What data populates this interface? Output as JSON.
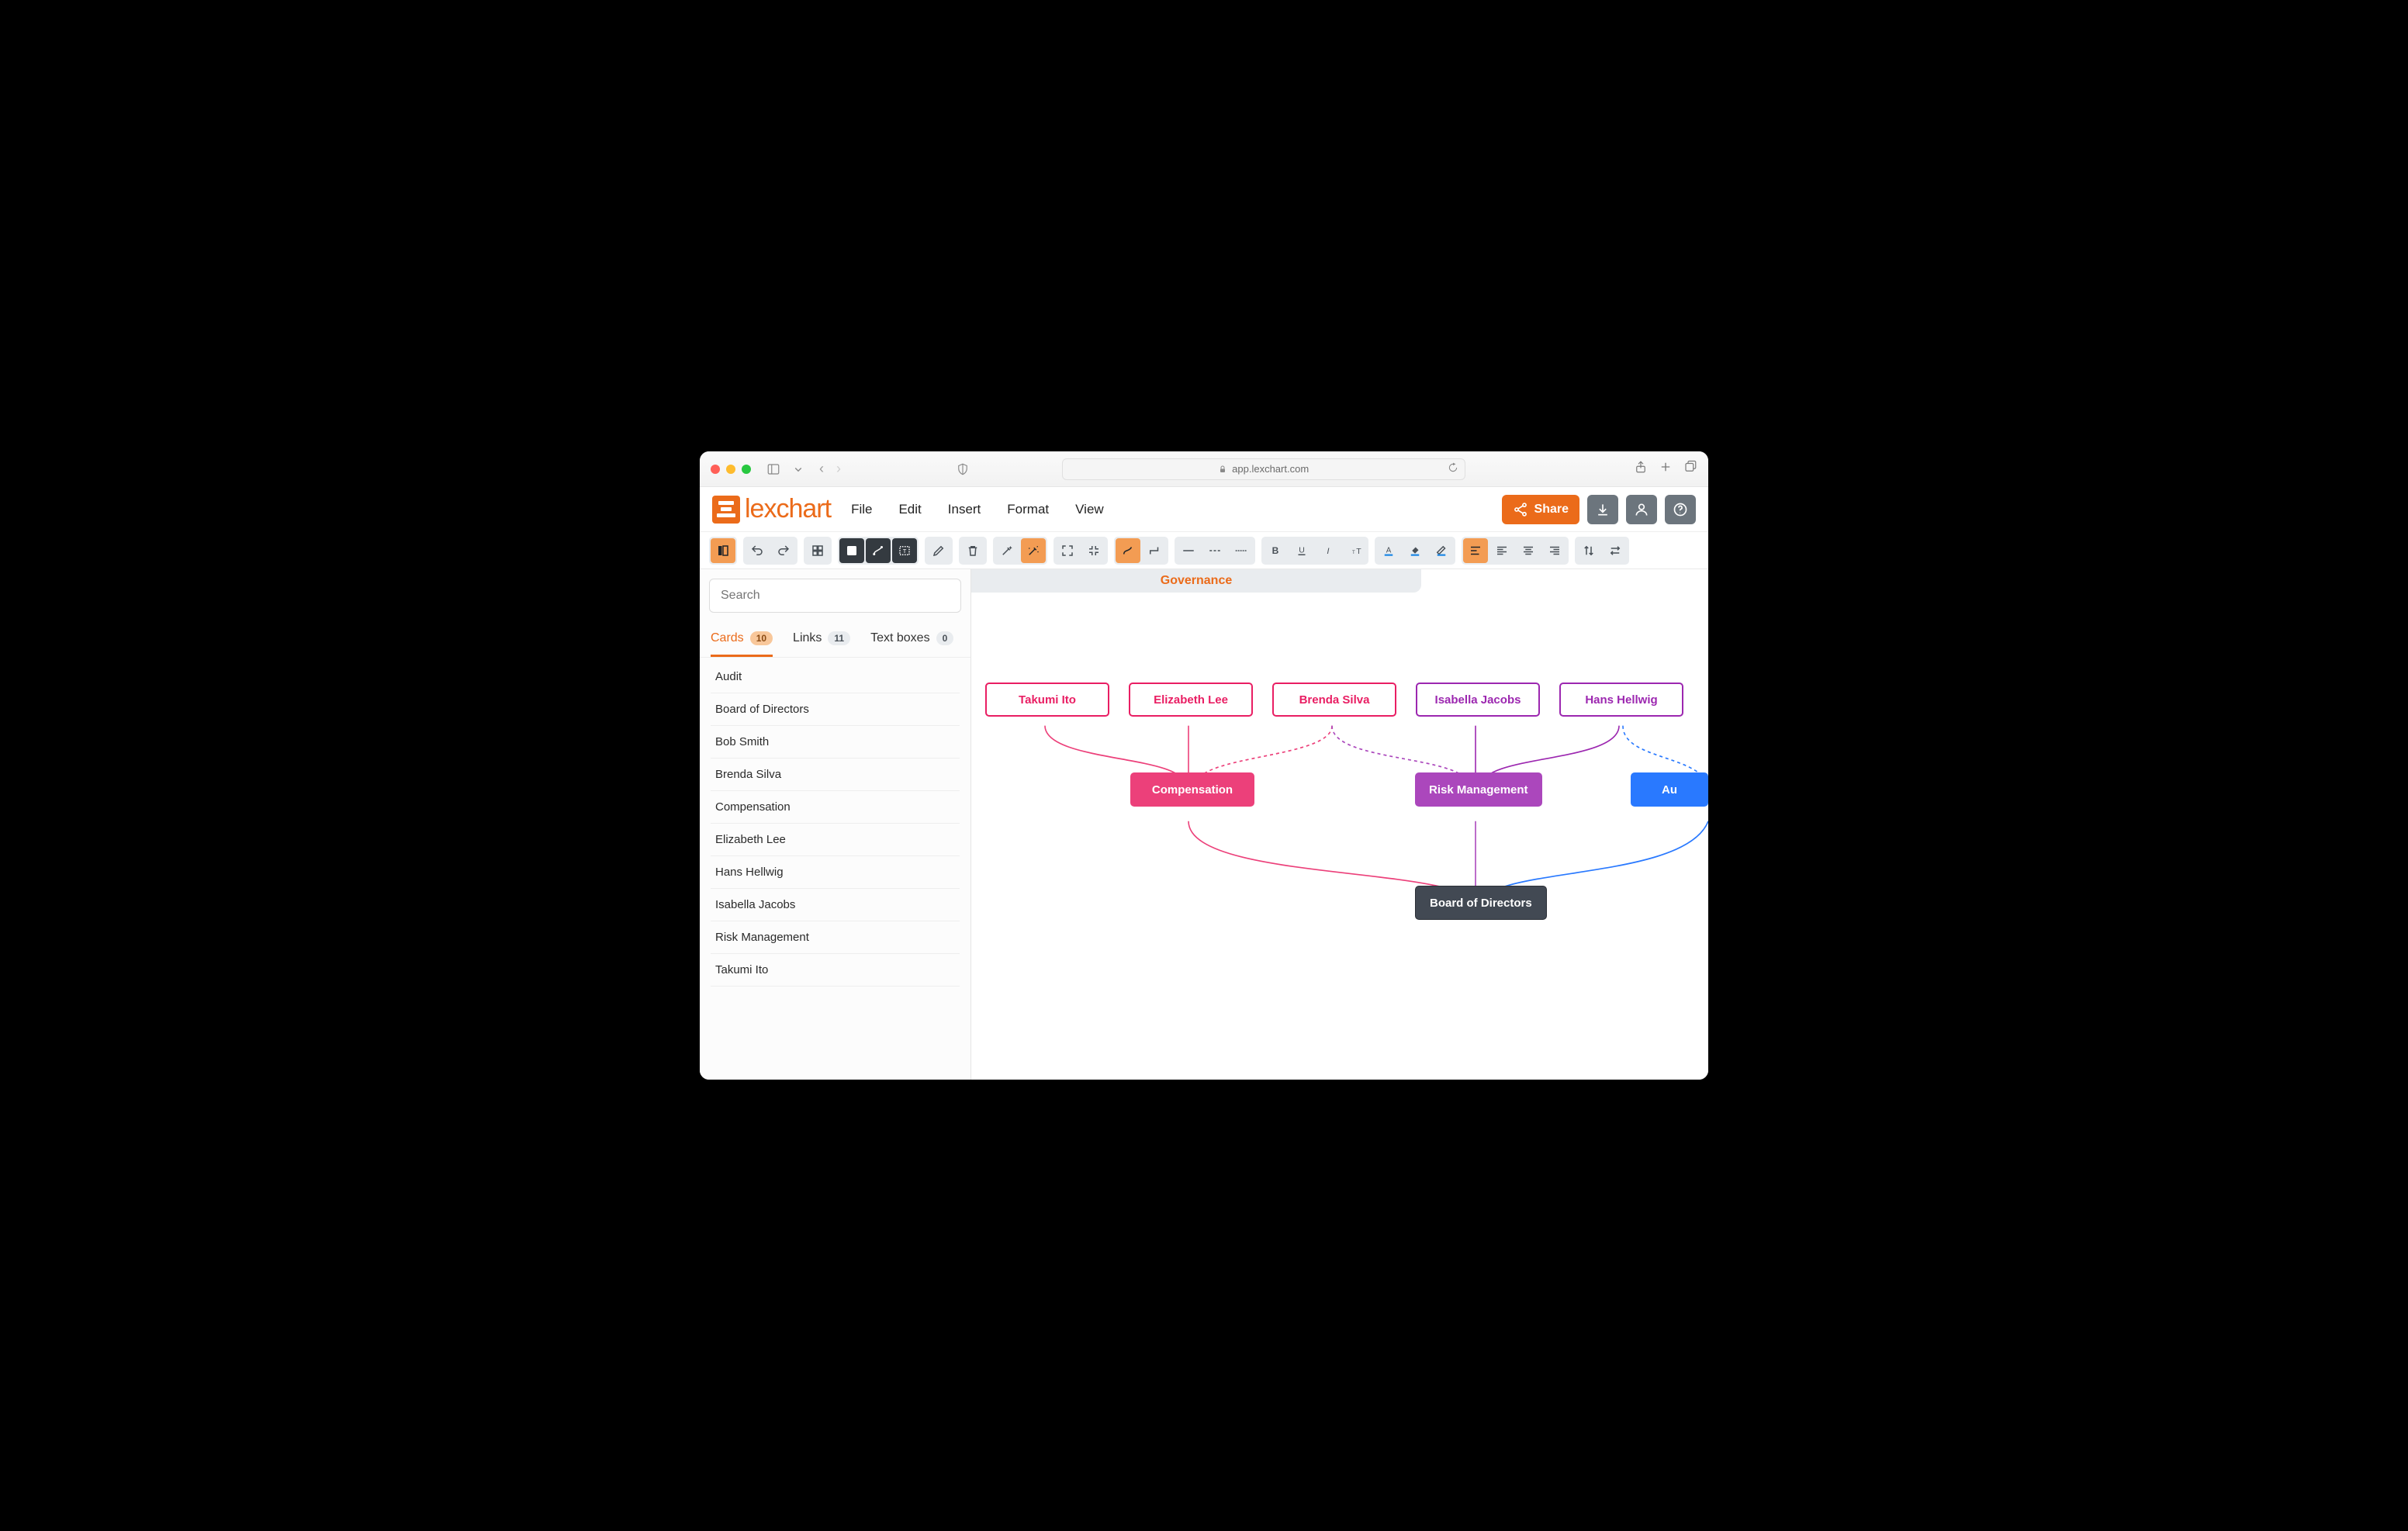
{
  "browser": {
    "url": "app.lexchart.com"
  },
  "app": {
    "logo_text": "lexchart",
    "menus": {
      "file": "File",
      "edit": "Edit",
      "insert": "Insert",
      "format": "Format",
      "view": "View"
    },
    "share_label": "Share"
  },
  "sidebar": {
    "search_placeholder": "Search",
    "tabs": {
      "cards": {
        "label": "Cards",
        "count": "10"
      },
      "links": {
        "label": "Links",
        "count": "11"
      },
      "textboxes": {
        "label": "Text boxes",
        "count": "0"
      }
    },
    "items": [
      "Audit",
      "Board of Directors",
      "Bob Smith",
      "Brenda Silva",
      "Compensation",
      "Elizabeth Lee",
      "Hans Hellwig",
      "Isabella Jacobs",
      "Risk Management",
      "Takumi Ito"
    ]
  },
  "chart": {
    "title": "Governance",
    "nodes": {
      "takumi": "Takumi Ito",
      "elizabeth": "Elizabeth Lee",
      "brenda": "Brenda Silva",
      "isabella": "Isabella Jacobs",
      "hans": "Hans Hellwig",
      "compensation": "Compensation",
      "risk": "Risk Management",
      "audit": "Au",
      "board": "Board of Directors"
    }
  },
  "chart_data": {
    "type": "org-hierarchy",
    "title": "Governance",
    "nodes": [
      {
        "id": "takumi",
        "label": "Takumi Ito",
        "kind": "person",
        "color": "#e91e63"
      },
      {
        "id": "elizabeth",
        "label": "Elizabeth Lee",
        "kind": "person",
        "color": "#e91e63"
      },
      {
        "id": "brenda",
        "label": "Brenda Silva",
        "kind": "person",
        "color": "#e91e63"
      },
      {
        "id": "isabella",
        "label": "Isabella Jacobs",
        "kind": "person",
        "color": "#9c27b0"
      },
      {
        "id": "hans",
        "label": "Hans Hellwig",
        "kind": "person",
        "color": "#9c27b0"
      },
      {
        "id": "compensation",
        "label": "Compensation",
        "kind": "committee",
        "color": "#ec407a"
      },
      {
        "id": "risk",
        "label": "Risk Management",
        "kind": "committee",
        "color": "#ab47bc"
      },
      {
        "id": "audit",
        "label": "Audit",
        "kind": "committee",
        "color": "#2979ff"
      },
      {
        "id": "board",
        "label": "Board of Directors",
        "kind": "board",
        "color": "#424953"
      }
    ],
    "edges": [
      {
        "from": "takumi",
        "to": "compensation",
        "style": "solid"
      },
      {
        "from": "elizabeth",
        "to": "compensation",
        "style": "solid"
      },
      {
        "from": "brenda",
        "to": "compensation",
        "style": "dashed"
      },
      {
        "from": "brenda",
        "to": "risk",
        "style": "dashed"
      },
      {
        "from": "isabella",
        "to": "risk",
        "style": "solid"
      },
      {
        "from": "hans",
        "to": "risk",
        "style": "solid"
      },
      {
        "from": "hans",
        "to": "audit",
        "style": "dashed"
      },
      {
        "from": "compensation",
        "to": "board",
        "style": "solid"
      },
      {
        "from": "risk",
        "to": "board",
        "style": "solid"
      },
      {
        "from": "audit",
        "to": "board",
        "style": "solid"
      }
    ]
  }
}
